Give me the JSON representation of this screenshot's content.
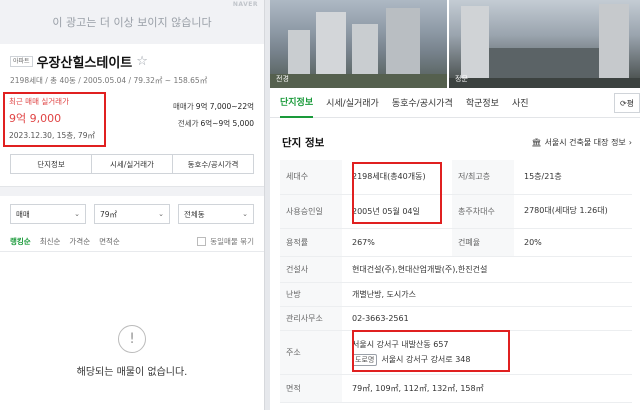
{
  "ad": {
    "text": "이 광고는 더 이상 보이지 않습니다",
    "badge": "NAVER"
  },
  "complex": {
    "type_tag": "아파트",
    "name": "우장산힐스테이트",
    "summary": "2198세대 / 총 40동 / 2005.05.04 / 79.32㎡ ~ 158.65㎡",
    "recent_label": "최근 매매 실거래가",
    "recent_price": "9억 9,000",
    "recent_date": "2023.12.30, 15층, 79㎡",
    "sale_label": "매매가",
    "sale_value": "9억 7,000~22억",
    "jeonse_label": "전세가",
    "jeonse_value": "6억~9억 5,000"
  },
  "action_buttons": [
    "단지정보",
    "시세/실거래가",
    "동호수/공시가격"
  ],
  "filters": {
    "deal": "매매",
    "area": "79㎡",
    "dong": "전체동"
  },
  "sort": {
    "options": [
      "랭킹순",
      "최신순",
      "가격순",
      "면적순"
    ],
    "same_listing": "동일매물 묶기"
  },
  "empty_message": "해당되는 매물이 없습니다.",
  "photos": {
    "caption1": "전경",
    "caption2": "정문"
  },
  "tabs": [
    "단지정보",
    "시세/실거래가",
    "동호수/공시가격",
    "학군정보",
    "사진"
  ],
  "tab_more": "평",
  "info": {
    "title": "단지 정보",
    "registry_link": "서울시 건축물 대장 정보",
    "rows": {
      "households_label": "세대수",
      "households_value": "2198세대(총40개동)",
      "floors_label": "저/최고층",
      "floors_value": "15층/21층",
      "approval_label": "사용승인일",
      "approval_value": "2005년 05월 04일",
      "parking_label": "총주차대수",
      "parking_value": "2780대(세대당 1.26대)",
      "far_label": "용적률",
      "far_value": "267%",
      "bcr_label": "건폐율",
      "bcr_value": "20%",
      "builder_label": "건설사",
      "builder_value": "현대건설(주),현대산업개발(주),한진건설",
      "heating_label": "난방",
      "heating_value": "개별난방, 도시가스",
      "office_label": "관리사무소",
      "office_value": "02-3663-2561",
      "address_label": "주소",
      "address_lot": "서울시 강서구 내발산동 657",
      "address_road_tag": "도로명",
      "address_road": "서울시 강서구 강서로 348",
      "area_label": "면적",
      "area_value": "79㎡, 109㎡, 112㎡, 132㎡, 158㎡"
    }
  }
}
